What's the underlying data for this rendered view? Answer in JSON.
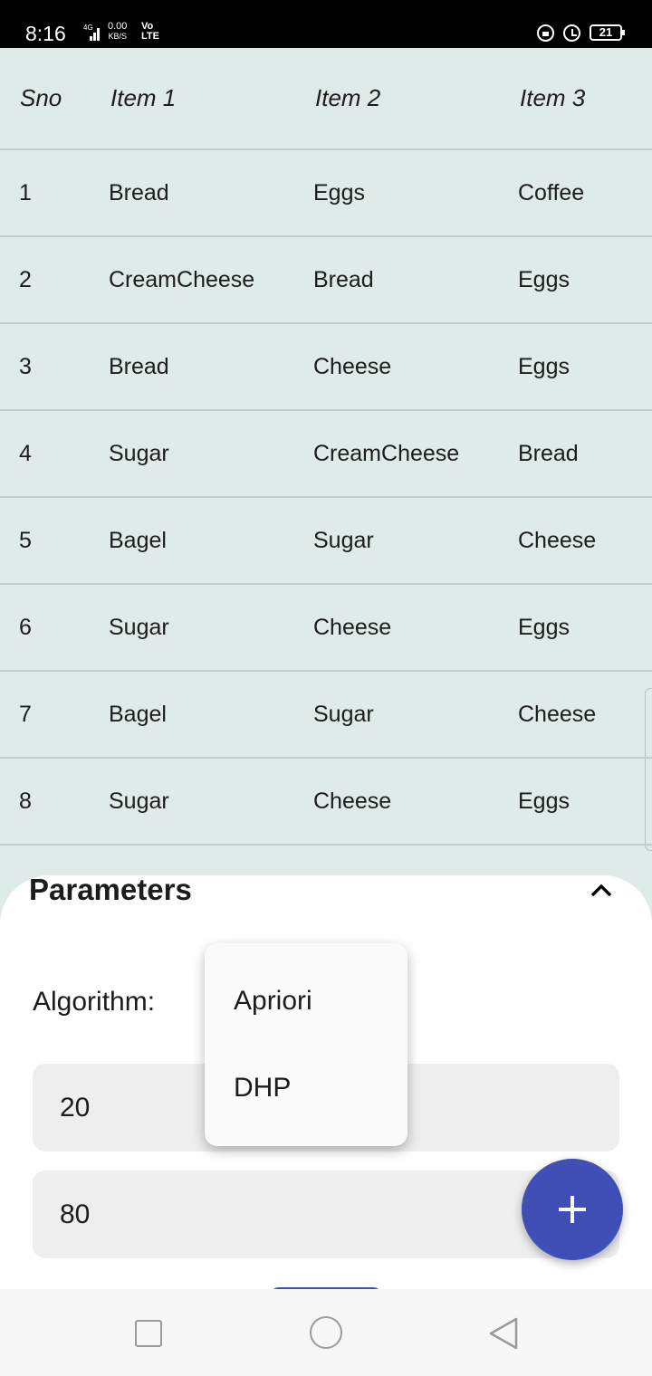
{
  "status_bar": {
    "time": "8:16",
    "network_type": "4G",
    "speed_value": "0.00",
    "speed_unit": "KB/S",
    "volte_top": "Vo",
    "volte_bottom": "LTE",
    "battery": "21"
  },
  "table": {
    "headers": [
      "Sno",
      "Item 1",
      "Item 2",
      "Item 3"
    ],
    "rows": [
      [
        "1",
        "Bread",
        "Eggs",
        "Coffee"
      ],
      [
        "2",
        "CreamCheese",
        "Bread",
        "Eggs"
      ],
      [
        "3",
        "Bread",
        "Cheese",
        "Eggs"
      ],
      [
        "4",
        "Sugar",
        "CreamCheese",
        "Bread"
      ],
      [
        "5",
        "Bagel",
        "Sugar",
        "Cheese"
      ],
      [
        "6",
        "Sugar",
        "Cheese",
        "Eggs"
      ],
      [
        "7",
        "Bagel",
        "Sugar",
        "Cheese"
      ],
      [
        "8",
        "Sugar",
        "Cheese",
        "Eggs"
      ]
    ]
  },
  "parameters": {
    "title": "Parameters",
    "algorithm_label": "Algorithm:",
    "support_value": "20",
    "confidence_value": "80"
  },
  "dropdown": {
    "options": [
      "Apriori",
      "DHP"
    ]
  },
  "colors": {
    "table_background": "#dfebe8",
    "accent": "#3f51b5"
  }
}
